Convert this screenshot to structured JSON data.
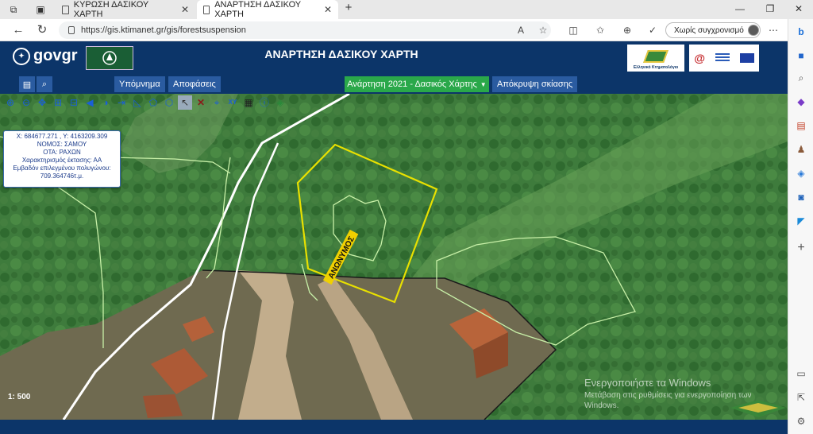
{
  "browser": {
    "tabs": [
      {
        "title": "ΚΥΡΩΣΗ ΔΑΣΙΚΟΥ ΧΑΡΤΗ",
        "active": false
      },
      {
        "title": "ΑΝΑΡΤΗΣΗ ΔΑΣΙΚΟΥ ΧΑΡΤΗ",
        "active": true
      }
    ],
    "new_tab_label": "+",
    "url": "https://gis.ktimanet.gr/gis/forestsuspension",
    "sync_label": "Χωρίς συγχρονισμό"
  },
  "header": {
    "govgr": "govgr",
    "title": "ΑΝΑΡΤΗΣΗ ΔΑΣΙΚΟΥ ΧΑΡΤΗ",
    "ktimatologio_label": "Ελληνικό Κτηματολόγιο"
  },
  "nav": {
    "legend_label": "Υπόμνημα",
    "decisions_label": "Αποφάσεις",
    "layer_label": "Ανάρτηση 2021 - Δασικός Χάρτης",
    "hide_shading_label": "Απόκρυψη σκίασης"
  },
  "info": {
    "coords": "X: 684677.271 , Y: 4163209.309",
    "nomos": "ΝΟΜΟΣ: ΣΑΜΟΥ",
    "ota": "ΟΤΑ: ΡΑΧΩΝ",
    "character": "Χαρακτηρισμός έκτασης: ΑΑ",
    "area_label": "Εμβαδόν επιλεγμένου πολυγώνου:",
    "area_value": "709.364746τ.μ."
  },
  "map": {
    "scale": "1: 500",
    "road_label": "ΑΝΩΝΥΜΟΣ",
    "polygon_color": "#e8e000",
    "boundary_color": "#c8f0a8"
  },
  "windows": {
    "line1": "Ενεργοποιήστε τα Windows",
    "line2": "Μετάβαση στις ρυθμίσεις για ενεργοποίηση των Windows."
  }
}
